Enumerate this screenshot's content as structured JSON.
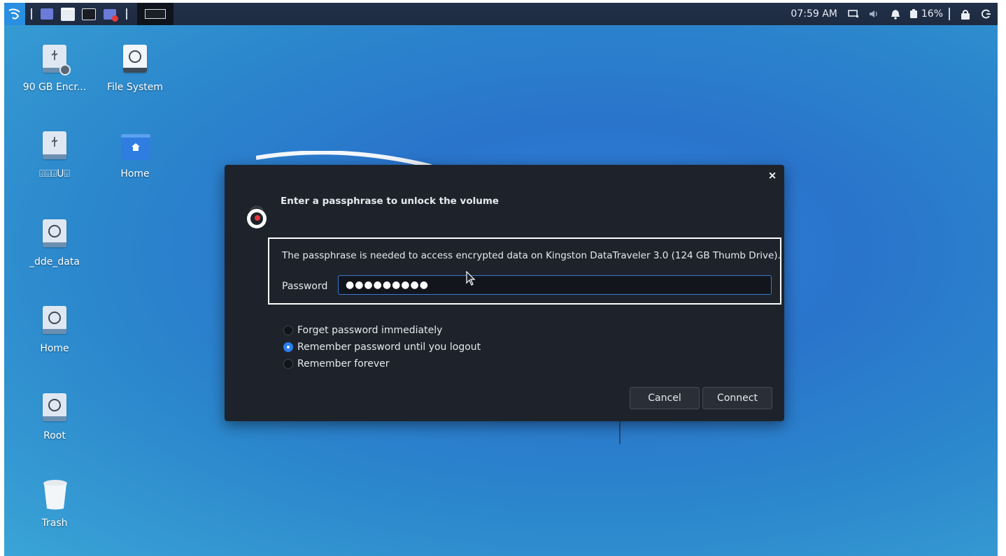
{
  "panel": {
    "clock": "07:59 AM",
    "battery_percent": "16%"
  },
  "desktop_icons": [
    {
      "label": "90 GB Encr..."
    },
    {
      "label": "File System"
    },
    {
      "label": "⌹⌹⌹U⌹"
    },
    {
      "label": "Home"
    },
    {
      "label": "_dde_data"
    },
    {
      "label": "Home"
    },
    {
      "label": "Root"
    },
    {
      "label": "Trash"
    }
  ],
  "dialog": {
    "title": "Enter a passphrase to unlock the volume",
    "message": "The passphrase is needed to access encrypted data on Kingston DataTraveler 3.0 (124 GB Thumb Drive).",
    "password_label": "Password",
    "password_value": "●●●●●●●●●",
    "options": [
      {
        "label": "Forget password immediately",
        "selected": false
      },
      {
        "label": "Remember password until you logout",
        "selected": true
      },
      {
        "label": "Remember forever",
        "selected": false
      }
    ],
    "cancel_label": "Cancel",
    "connect_label": "Connect",
    "close_glyph": "×"
  },
  "colors": {
    "accent": "#2a80ee",
    "dialog_bg": "#1e232b"
  }
}
